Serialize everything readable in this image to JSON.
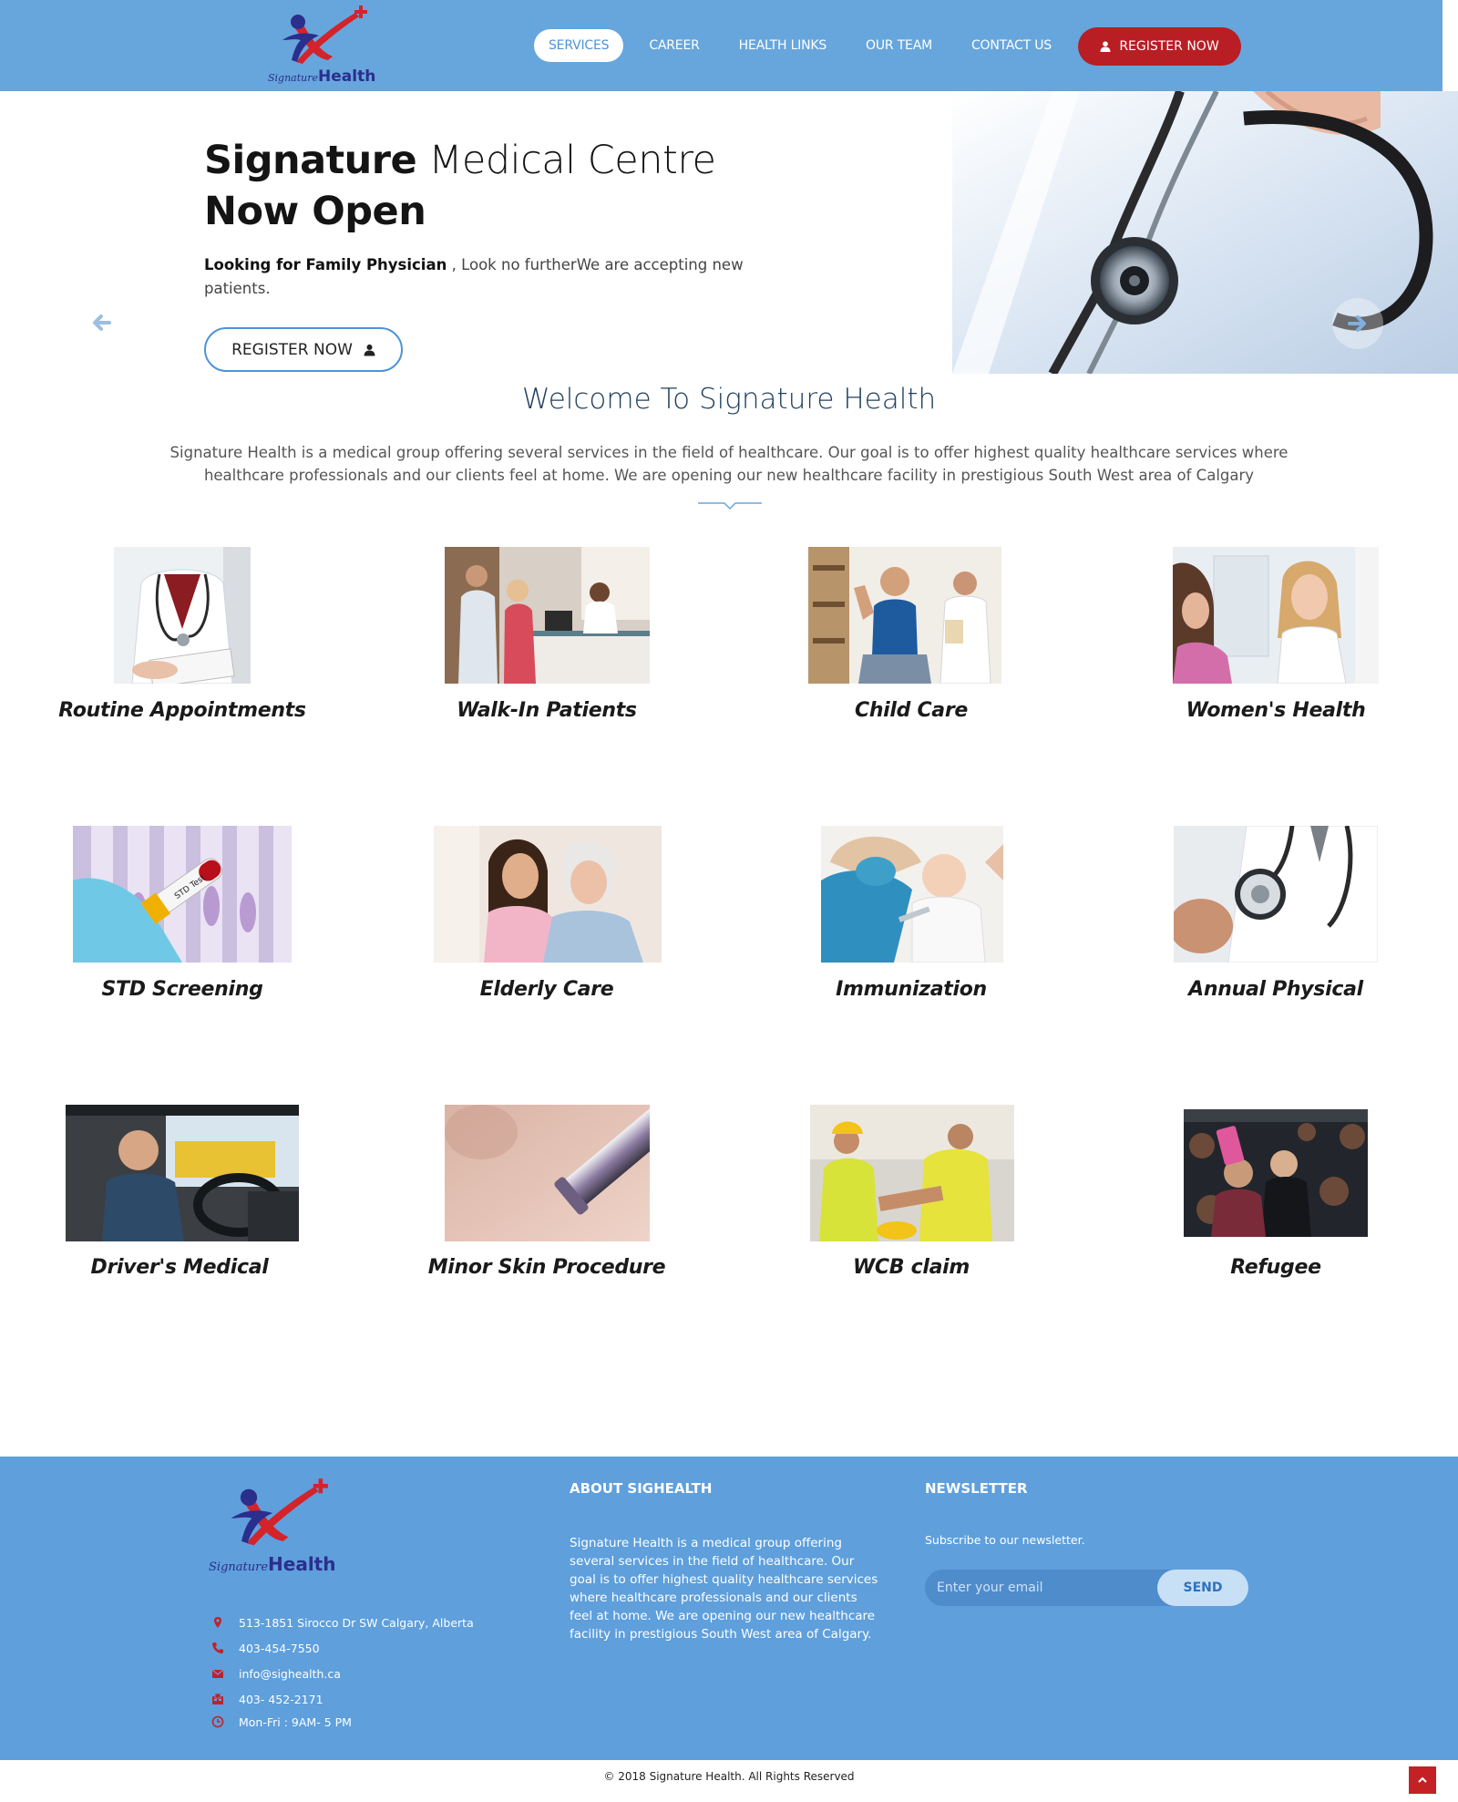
{
  "header": {
    "logo": {
      "sig": "Signature",
      "health": "Health"
    },
    "nav": [
      {
        "label": "SERVICES",
        "active": true
      },
      {
        "label": "CAREER"
      },
      {
        "label": "HEALTH LINKS"
      },
      {
        "label": "OUR TEAM"
      },
      {
        "label": "CONTACT US"
      }
    ],
    "register_label": "REGISTER NOW"
  },
  "hero": {
    "title_bold": "Signature",
    "title_rest": " Medical Centre",
    "title_line2": "Now Open",
    "text_bold": "Looking for Family Physician",
    "text_rest": " , Look no furtherWe are accepting new patients.",
    "button_label": "REGISTER NOW"
  },
  "welcome": {
    "title": "Welcome To Signature Health",
    "text": "Signature Health is a medical group offering several services in the field of healthcare. Our goal is to offer highest quality healthcare services where healthcare professionals and our clients feel at home. We are opening our new healthcare facility in prestigious South West area of Calgary"
  },
  "services": [
    "Routine Appointments",
    "Walk-In Patients",
    "Child Care",
    "Women's Health",
    "STD Screening",
    "Elderly Care",
    "Immunization",
    "Annual Physical",
    "Driver's Medical",
    "Minor Skin Procedure",
    "WCB claim",
    "Refugee"
  ],
  "footer": {
    "logo": {
      "sig": "Signature",
      "health": "Health"
    },
    "contacts": {
      "address": "513-1851 Sirocco Dr SW Calgary, Alberta",
      "phone": "403-454-7550",
      "email": "info@sighealth.ca",
      "fax": "403- 452-2171",
      "hours": "Mon-Fri : 9AM- 5 PM"
    },
    "about_heading": "ABOUT SIGHEALTH",
    "about_text": "Signature Health is a medical group offering several services in the field of healthcare. Our goal is to offer highest quality healthcare services where healthcare professionals and our clients feel at home. We are opening our new healthcare facility in prestigious South West area of Calgary.",
    "newsletter_heading": "NEWSLETTER",
    "newsletter_text": "Subscribe to our newsletter.",
    "email_placeholder": "Enter your email",
    "send_label": "SEND"
  },
  "copyright": "© 2018 Signature Health. All Rights Reserved",
  "colors": {
    "header_bg": "#66a6dc",
    "accent_red": "#b81e24",
    "footer_bg": "#5e9fdc",
    "brand_navy": "#2b2e8c"
  }
}
